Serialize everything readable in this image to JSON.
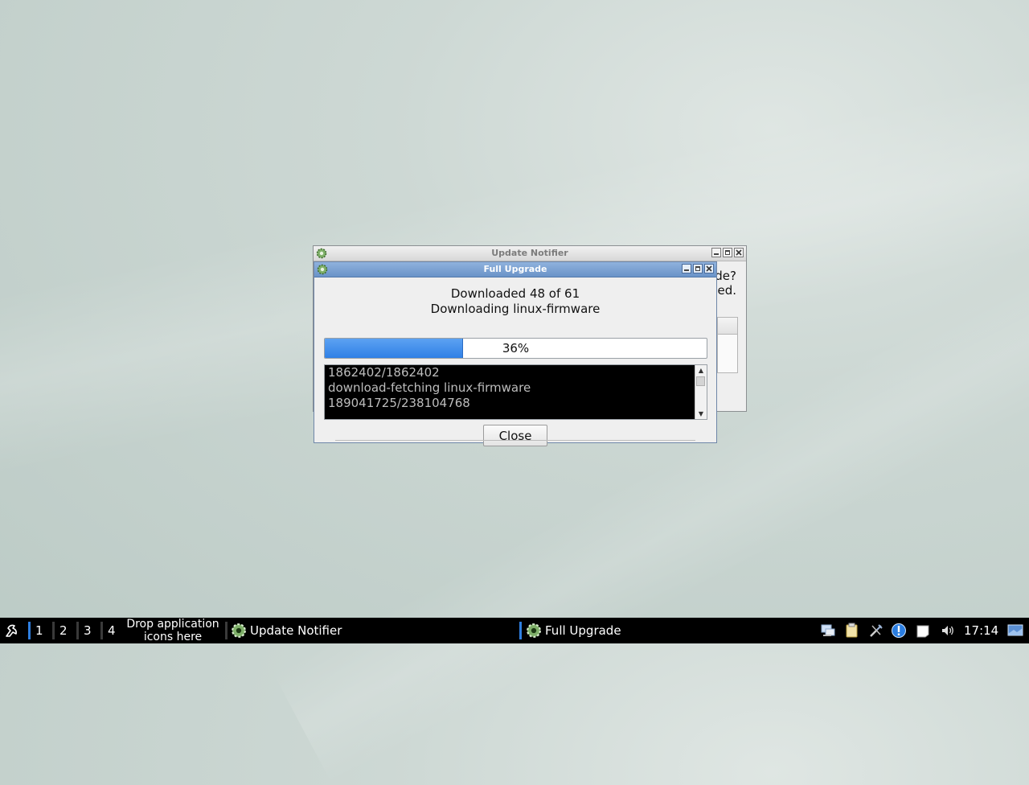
{
  "background_window": {
    "title": "Update Notifier",
    "partial_text_1": "de?",
    "partial_text_2": "ed."
  },
  "upgrade_dialog": {
    "title": "Full Upgrade",
    "downloaded_text": "Downloaded 48 of 61",
    "downloading_text": "Downloading linux-firmware",
    "progress": {
      "percent": 36,
      "label": "36%"
    },
    "log_lines": [
      "1862402/1862402",
      "download-fetching linux-firmware",
      "189041725/238104768"
    ],
    "close_button": "Close"
  },
  "taskbar": {
    "desktops": [
      "1",
      "2",
      "3",
      "4"
    ],
    "drop_text_line1": "Drop application",
    "drop_text_line2": "icons here",
    "tasks": [
      {
        "label": "Update Notifier",
        "icon": "gear-icon"
      },
      {
        "label": "Full Upgrade",
        "icon": "gear-icon"
      }
    ],
    "tray_icons": [
      "network-icon",
      "clipboard-icon",
      "tools-icon",
      "update-alert-icon",
      "notes-icon",
      "volume-icon",
      "screen-icon"
    ],
    "clock": "17:14"
  },
  "colors": {
    "progress_fill": "#3a8aec",
    "active_titlebar": "#7aa0d2",
    "taskbar": "#000000",
    "separator_accent": "#2f7fe0"
  }
}
